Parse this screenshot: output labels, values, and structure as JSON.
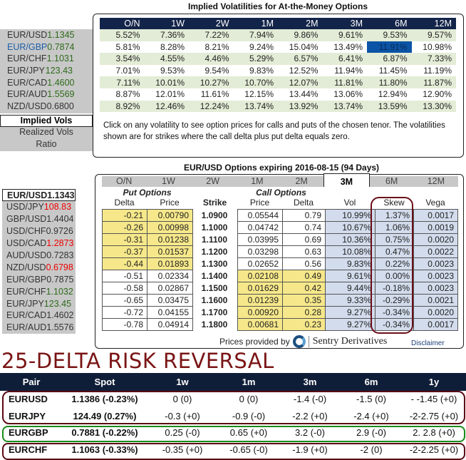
{
  "implied": {
    "title": "Implied Volatilities for At-the-Money Options",
    "tenors": [
      "O/N",
      "1W",
      "2W",
      "1M",
      "2M",
      "3M",
      "6M",
      "12M"
    ],
    "pairs": [
      {
        "pair": "EUR/USD",
        "spot": "1.1345",
        "pc": "#333",
        "sc": "#2d6a1a"
      },
      {
        "pair": "EUR/GBP",
        "spot": "0.7874",
        "pc": "#1e5fa8",
        "sc": "#2d6a1a"
      },
      {
        "pair": "EUR/CHF",
        "spot": "1.1031",
        "pc": "#333",
        "sc": "#2d6a1a"
      },
      {
        "pair": "EUR/JPY",
        "spot": "123.43",
        "pc": "#333",
        "sc": "#2d6a1a"
      },
      {
        "pair": "EUR/CAD",
        "spot": "1.4600",
        "pc": "#333",
        "sc": "#2d6a1a"
      },
      {
        "pair": "EUR/AUD",
        "spot": "1.5569",
        "pc": "#333",
        "sc": "#2d6a1a"
      },
      {
        "pair": "NZD/USD",
        "spot": "0.6800",
        "pc": "#333",
        "sc": "#333"
      }
    ],
    "rows": [
      [
        "5.52%",
        "7.36%",
        "7.22%",
        "7.94%",
        "9.86%",
        "9.61%",
        "9.53%",
        "9.57%"
      ],
      [
        "5.81%",
        "8.28%",
        "8.21%",
        "9.24%",
        "15.04%",
        "13.49%",
        "11.91%",
        "10.98%"
      ],
      [
        "3.54%",
        "4.55%",
        "4.46%",
        "5.29%",
        "6.57%",
        "6.41%",
        "6.87%",
        "7.33%"
      ],
      [
        "7.01%",
        "9.53%",
        "9.54%",
        "9.83%",
        "12.52%",
        "11.94%",
        "11.45%",
        "11.19%"
      ],
      [
        "7.11%",
        "10.01%",
        "10.27%",
        "10.70%",
        "12.07%",
        "11.81%",
        "11.80%",
        "11.87%"
      ],
      [
        "8.87%",
        "12.01%",
        "11.61%",
        "12.15%",
        "13.44%",
        "13.06%",
        "12.94%",
        "12.90%"
      ],
      [
        "8.92%",
        "12.46%",
        "12.24%",
        "13.74%",
        "13.92%",
        "13.74%",
        "13.59%",
        "13.30%"
      ]
    ],
    "note": "Click on any volatility to see option prices for calls and puts of the chosen tenor. The volatilities shown are for strikes where the call delta plus put delta equals zero.",
    "menu": [
      "Implied Vols",
      "Realized Vols",
      "Ratio"
    ]
  },
  "options": {
    "title": "EUR/USD Options expiring 2016-08-15 (94 Days)",
    "tabs": [
      "O/N",
      "1W",
      "2W",
      "1M",
      "2M",
      "3M",
      "6M",
      "12M"
    ],
    "active_tab": "3M",
    "put_label": "Put Options",
    "call_label": "Call Options",
    "headers": [
      "Delta",
      "Price",
      "Strike",
      "Price",
      "Delta",
      "Vol",
      "Skew",
      "Vega"
    ],
    "rows": [
      [
        "-0.21",
        "0.00790",
        "1.0900",
        "0.05544",
        "0.79",
        "10.99%",
        "1.37%",
        "0.0017"
      ],
      [
        "-0.26",
        "0.00998",
        "1.1000",
        "0.04742",
        "0.74",
        "10.67%",
        "1.06%",
        "0.0019"
      ],
      [
        "-0.31",
        "0.01238",
        "1.1100",
        "0.03995",
        "0.69",
        "10.36%",
        "0.75%",
        "0.0020"
      ],
      [
        "-0.37",
        "0.01537",
        "1.1200",
        "0.03298",
        "0.63",
        "10.08%",
        "0.47%",
        "0.0022"
      ],
      [
        "-0.44",
        "0.01893",
        "1.1300",
        "0.02652",
        "0.56",
        "9.83%",
        "0.22%",
        "0.0023"
      ],
      [
        "-0.51",
        "0.02334",
        "1.1400",
        "0.02108",
        "0.49",
        "9.61%",
        "0.00%",
        "0.0023"
      ],
      [
        "-0.58",
        "0.02867",
        "1.1500",
        "0.01629",
        "0.42",
        "9.44%",
        "-0.18%",
        "0.0023"
      ],
      [
        "-0.65",
        "0.03475",
        "1.1600",
        "0.01239",
        "0.35",
        "9.33%",
        "-0.29%",
        "0.0021"
      ],
      [
        "-0.72",
        "0.04155",
        "1.1700",
        "0.00920",
        "0.28",
        "9.27%",
        "-0.34%",
        "0.0020"
      ],
      [
        "-0.78",
        "0.04914",
        "1.1800",
        "0.00681",
        "0.23",
        "9.27%",
        "-0.34%",
        "0.0017"
      ]
    ],
    "provided_by": "Prices provided by",
    "provider": "Sentry Derivatives",
    "disclaimer": "Disclaimer",
    "selected": {
      "pair": "EUR/USD",
      "spot": "1.1343"
    },
    "spots": [
      {
        "pair": "USD/JPY",
        "spot": "108.83",
        "c": "#e00"
      },
      {
        "pair": "GBP/USD",
        "spot": "1.4404",
        "c": "#333"
      },
      {
        "pair": "USD/CHF",
        "spot": "0.9726",
        "c": "#333"
      },
      {
        "pair": "USD/CAD",
        "spot": "1.2873",
        "c": "#e00"
      },
      {
        "pair": "AUD/USD",
        "spot": "0.7283",
        "c": "#333"
      },
      {
        "pair": "NZD/USD",
        "spot": "0.6798",
        "c": "#e00"
      },
      {
        "pair": "EUR/GBP",
        "spot": "0.7875",
        "c": "#333"
      },
      {
        "pair": "EUR/CHF",
        "spot": "1.1032",
        "c": "#2d6a1a"
      },
      {
        "pair": "EUR/JPY",
        "spot": "123.45",
        "c": "#2d6a1a"
      },
      {
        "pair": "EUR/CAD",
        "spot": "1.4602",
        "c": "#333"
      },
      {
        "pair": "EUR/AUD",
        "spot": "1.5576",
        "c": "#333"
      }
    ]
  },
  "risk_reversal": {
    "title": "25-DELTA RISK REVERSAL",
    "title_color": "#7a1414",
    "headers": [
      "Pair",
      "Spot",
      "1w",
      "1m",
      "3m",
      "6m",
      "1y"
    ],
    "rows": [
      [
        "EURUSD",
        "1.1386 (-0.23%)",
        "0 (0)",
        "0 (0)",
        "-1.4 (-0)",
        "-1.5 (0)",
        "- -1.45 (+0)"
      ],
      [
        "EURJPY",
        "124.49 (0.27%)",
        "-0.3 (+0)",
        "-0.9 (-0)",
        "-2.2 (+0)",
        "-2.4 (+0)",
        "-2-2.75 (+0)"
      ],
      [
        "EURGBP",
        "0.7881 (-0.22%)",
        "0.25 (-0)",
        "0.65 (+0)",
        "3.2 (-0)",
        "2.9 (-0)",
        "2. 2.8 (+0)"
      ],
      [
        "EURCHF",
        "1.1063 (-0.33%)",
        "-0.35 (+0)",
        "-0.65 (-0)",
        "-1.9 (+0)",
        "-2 (0)",
        "-2-2.25 (+0)"
      ]
    ]
  }
}
